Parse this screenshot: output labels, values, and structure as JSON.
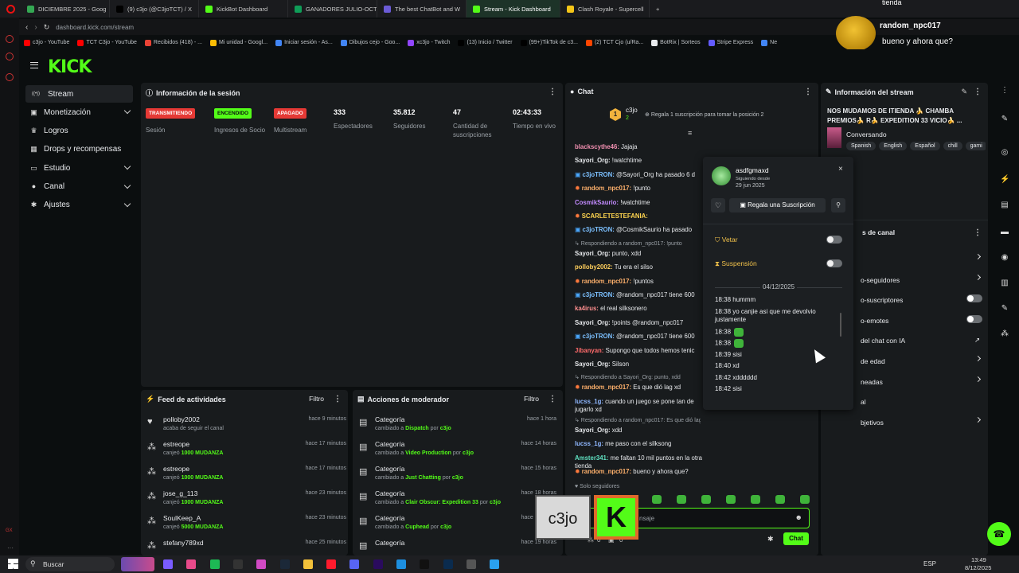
{
  "browser": {
    "tabs": [
      {
        "label": "DICIEMBRE 2025 - Goog",
        "color": "#34a853"
      },
      {
        "label": "(9) c3jo (@C3joTCT) / X",
        "color": "#000000"
      },
      {
        "label": "KickBot Dashboard",
        "color": "#53fc18"
      },
      {
        "label": "GANADORES JULIO-OCT",
        "color": "#0f9d58"
      },
      {
        "label": "The best ChatBot and W",
        "color": "#6b5bd6"
      },
      {
        "label": "Stream - Kick Dashboard",
        "color": "#53fc18"
      },
      {
        "label": "Clash Royale - Supercell",
        "color": "#f5c518"
      }
    ],
    "new_tab": "+",
    "url": "dashboard.kick.com/stream",
    "bookmarks": [
      {
        "label": "c3jo - YouTube",
        "color": "#ff0000"
      },
      {
        "label": "TCT C3jo - YouTube",
        "color": "#ff0000"
      },
      {
        "label": "Recibidos (418) - ...",
        "color": "#ea4335"
      },
      {
        "label": "Mi unidad - Googl...",
        "color": "#fbbc04"
      },
      {
        "label": "Iniciar sesión - As...",
        "color": "#4285f4"
      },
      {
        "label": "Dibujos cejo - Goo...",
        "color": "#4285f4"
      },
      {
        "label": "xc3jo - Twitch",
        "color": "#9146ff"
      },
      {
        "label": "(13) Inicio / Twitter",
        "color": "#000000"
      },
      {
        "label": "(99+)TikTok de c3...",
        "color": "#000000"
      },
      {
        "label": "(2) TCT Cjo (u/Ra...",
        "color": "#ff4500"
      },
      {
        "label": "BotRix | Sorteos",
        "color": "#e8eaed"
      },
      {
        "label": "Stripe Express",
        "color": "#635bff"
      },
      {
        "label": "Ne",
        "color": "#4285f4"
      }
    ]
  },
  "overlay_chat": {
    "top_text": "tienda",
    "username": "random_npc017",
    "message": "bueno y ahora que?"
  },
  "sidebar": {
    "items": [
      {
        "label": "Stream",
        "icon": "broadcast-icon",
        "glyph": "((•))",
        "has_chevron": false,
        "active": true
      },
      {
        "label": "Monetización",
        "icon": "wallet-icon",
        "glyph": "▣",
        "has_chevron": true,
        "active": false
      },
      {
        "label": "Logros",
        "icon": "trophy-icon",
        "glyph": "♛",
        "has_chevron": false,
        "active": false
      },
      {
        "label": "Drops y recompensas",
        "icon": "gift-icon",
        "glyph": "▦",
        "has_chevron": false,
        "active": false
      },
      {
        "label": "Estudio",
        "icon": "camera-icon",
        "glyph": "▭",
        "has_chevron": true,
        "active": false
      },
      {
        "label": "Canal",
        "icon": "user-icon",
        "glyph": "●",
        "has_chevron": true,
        "active": false
      },
      {
        "label": "Ajustes",
        "icon": "gear-icon",
        "glyph": "✱",
        "has_chevron": true,
        "active": false
      }
    ]
  },
  "session": {
    "title": "Información de la sesión",
    "stats": [
      {
        "badge": "TRANSMITIENDO",
        "badge_color": "#e53935",
        "badge_text_color": "#ffffff",
        "label": "Sesión"
      },
      {
        "badge": "ENCENDIDO",
        "badge_color": "#53fc18",
        "badge_text_color": "#0b0e0f",
        "label": "Ingresos de Socio"
      },
      {
        "badge": "APAGADO",
        "badge_color": "#e53935",
        "badge_text_color": "#ffffff",
        "label": "Multistream"
      },
      {
        "value": "333",
        "label": "Espectadores"
      },
      {
        "value": "35.812",
        "label": "Seguidores"
      },
      {
        "value": "47",
        "label": "Cantidad de suscripciones"
      },
      {
        "value": "02:43:33",
        "label": "Tiempo en vivo"
      }
    ]
  },
  "feed": {
    "title": "Feed de actividades",
    "filter": "Filtro",
    "rows": [
      {
        "name": "polloby2002",
        "sub": "acaba de seguir el canal",
        "amount": "",
        "time": "hace 9 minutos",
        "icon": "heart-icon",
        "glyph": "♥"
      },
      {
        "name": "estreope",
        "sub": "canjeó",
        "amount": "1000 MUDANZA",
        "time": "hace 17 minutos",
        "icon": "points-icon",
        "glyph": "⁂"
      },
      {
        "name": "estreope",
        "sub": "canjeó",
        "amount": "1000 MUDANZA",
        "time": "hace 17 minutos",
        "icon": "points-icon",
        "glyph": "⁂"
      },
      {
        "name": "jose_g_113",
        "sub": "canjeó",
        "amount": "1000 MUDANZA",
        "time": "hace 23 minutos",
        "icon": "points-icon",
        "glyph": "⁂"
      },
      {
        "name": "SoulKeep_A",
        "sub": "canjeó",
        "amount": "5000 MUDANZA",
        "time": "hace 23 minutos",
        "icon": "points-icon",
        "glyph": "⁂"
      },
      {
        "name": "stefany789xd",
        "sub": "",
        "amount": "",
        "time": "hace 25 minutos",
        "icon": "points-icon",
        "glyph": "⁂"
      }
    ]
  },
  "modactions": {
    "title": "Acciones de moderador",
    "filter": "Filtro",
    "rows": [
      {
        "name": "Categoría",
        "pre": "cambiado a",
        "target": "Dispatch",
        "by": "por",
        "user": "c3jo",
        "time": "hace 1 hora"
      },
      {
        "name": "Categoría",
        "pre": "cambiado a",
        "target": "Video Production",
        "by": "por",
        "user": "c3jo",
        "time": "hace 14 horas"
      },
      {
        "name": "Categoría",
        "pre": "cambiado a",
        "target": "Just Chatting",
        "by": "por",
        "user": "c3jo",
        "time": "hace 15 horas"
      },
      {
        "name": "Categoría",
        "pre": "cambiado a",
        "target": "Clair Obscur: Expedition 33",
        "by": "por",
        "user": "c3jo",
        "time": "hace 18 horas"
      },
      {
        "name": "Categoría",
        "pre": "cambiado a",
        "target": "Cuphead",
        "by": "por",
        "user": "c3jo",
        "time": "hace 19 horas"
      },
      {
        "name": "Categoría",
        "pre": "",
        "target": "",
        "by": "",
        "user": "",
        "time": "hace 19 horas"
      }
    ]
  },
  "chat": {
    "title": "Chat",
    "top_gifter": {
      "rank": "1",
      "name": "c3jo",
      "count": "2",
      "cta": "Regala 1 suscripción para tomar la posición 2"
    },
    "messages": [
      {
        "user": "blackscythe46",
        "color": "#f08fb0",
        "text": "Jajaja",
        "reply": ""
      },
      {
        "user": "Sayori_Org",
        "color": "#e8eaed",
        "text": "!watchtime",
        "reply": ""
      },
      {
        "user": "c3joTRON",
        "color": "#7cc0ff",
        "text": "@Sayori_Org ha pasado 6 d",
        "reply": ""
      },
      {
        "user": "random_npc017",
        "color": "#ffb16c",
        "text": "!punto",
        "reply": ""
      },
      {
        "user": "CosmikSaurio",
        "color": "#c38bff",
        "text": "!watchtime",
        "reply": ""
      },
      {
        "user": "SCARLETESTEFANIA",
        "color": "#ffd54f",
        "text": "",
        "reply": ""
      },
      {
        "user": "c3joTRON",
        "color": "#7cc0ff",
        "text": "@CosmikSaurio ha pasado",
        "reply": ""
      },
      {
        "user": "Sayori_Org",
        "color": "#e8eaed",
        "text": "punto, xdd",
        "reply": "Respondiendo a random_npc017: !punto"
      },
      {
        "user": "polloby2002",
        "color": "#ffcf5c",
        "text": "Tu era el silso",
        "reply": ""
      },
      {
        "user": "random_npc017",
        "color": "#ffb16c",
        "text": "!puntos",
        "reply": ""
      },
      {
        "user": "c3joTRON",
        "color": "#7cc0ff",
        "text": "@random_npc017 tiene 600",
        "reply": ""
      },
      {
        "user": "ka4irus",
        "color": "#ff8f8f",
        "text": "el real silksonero",
        "reply": ""
      },
      {
        "user": "Sayori_Org",
        "color": "#e8eaed",
        "text": "!points @random_npc017",
        "reply": ""
      },
      {
        "user": "c3joTRON",
        "color": "#7cc0ff",
        "text": "@random_npc017 tiene 600",
        "reply": ""
      },
      {
        "user": "Jibanyan",
        "color": "#ff6b6b",
        "text": "Supongo que todos hemos tenic",
        "reply": ""
      },
      {
        "user": "Sayori_Org",
        "color": "#e8eaed",
        "text": "Silson",
        "reply": ""
      },
      {
        "user": "random_npc017",
        "color": "#ffb16c",
        "text": "Es que dió lag xd",
        "reply": "Respondiendo a Sayori_Org: punto, xdd"
      },
      {
        "user": "lucss_1g",
        "color": "#8fb7ff",
        "text": "cuando un juego se pone tan de jugarlo xd",
        "reply": ""
      },
      {
        "user": "Sayori_Org",
        "color": "#e8eaed",
        "text": "xdd",
        "reply": "Respondiendo a random_npc017: Es que dió lag xd"
      },
      {
        "user": "lucss_1g",
        "color": "#8fb7ff",
        "text": "me paso con el silksong",
        "reply": ""
      },
      {
        "user": "Amster341",
        "color": "#5fe0c0",
        "text": "me faltan 10 mil puntos en la otra tienda",
        "reply": ""
      },
      {
        "user": "random_npc017",
        "color": "#ffb16c",
        "text": "bueno y ahora que?",
        "reply": ""
      }
    ],
    "followers_only": "Solo seguidores",
    "input_placeholder": "nsaje",
    "send_button": "Chat",
    "counters": {
      "left": "0",
      "right": "0"
    }
  },
  "user_card": {
    "username": "asdfgmaxd",
    "following_label": "Siguiendo desde",
    "following_date": "29 jun 2025",
    "gift_button": "Regala una Suscripción",
    "veto_label": "Vetar",
    "suspension_label": "Suspensión",
    "date_divider": "04/12/2025",
    "history": [
      {
        "time": "18:38",
        "text": "hummm",
        "emote": false
      },
      {
        "time": "18:38",
        "text": "yo canjie asi que me devolvio justamente",
        "emote": false
      },
      {
        "time": "18:38",
        "text": "",
        "emote": true
      },
      {
        "time": "18:38",
        "text": "",
        "emote": true
      },
      {
        "time": "18:39",
        "text": "sisi",
        "emote": false
      },
      {
        "time": "18:40",
        "text": "xd",
        "emote": false
      },
      {
        "time": "18:42",
        "text": "xdddddd",
        "emote": false
      },
      {
        "time": "18:42",
        "text": "sisi",
        "emote": false
      }
    ]
  },
  "stream_info": {
    "title": "Información del stream",
    "stream_title": "NOS MUDAMOS DE ITIENDA 🍌 CHAMBA PREMIOS🍌 R🍌 EXPEDITION 33 VICIO🍌 ...",
    "category": "Conversando",
    "tags": [
      "Spanish",
      "English",
      "Español",
      "chill",
      "gami"
    ]
  },
  "channel_settings": {
    "title": "s de canal",
    "rows": [
      {
        "label": "",
        "control": "chevron"
      },
      {
        "label": "o-seguidores",
        "control": "chevron"
      },
      {
        "label": "o-suscriptores",
        "control": "toggle"
      },
      {
        "label": "o-emotes",
        "control": "toggle"
      },
      {
        "label": "del chat con IA",
        "control": "external"
      },
      {
        "label": "de edad",
        "control": "chevron"
      },
      {
        "label": "neadas",
        "control": "chevron"
      },
      {
        "label": "al",
        "control": "none"
      },
      {
        "label": "bjetivos",
        "control": "chevron"
      }
    ]
  },
  "watermark": {
    "text": "c3jo",
    "logo_letter": "K"
  },
  "taskbar": {
    "search": "Buscar",
    "lang": "ESP",
    "time": "13:49",
    "date": "8/12/2025"
  }
}
